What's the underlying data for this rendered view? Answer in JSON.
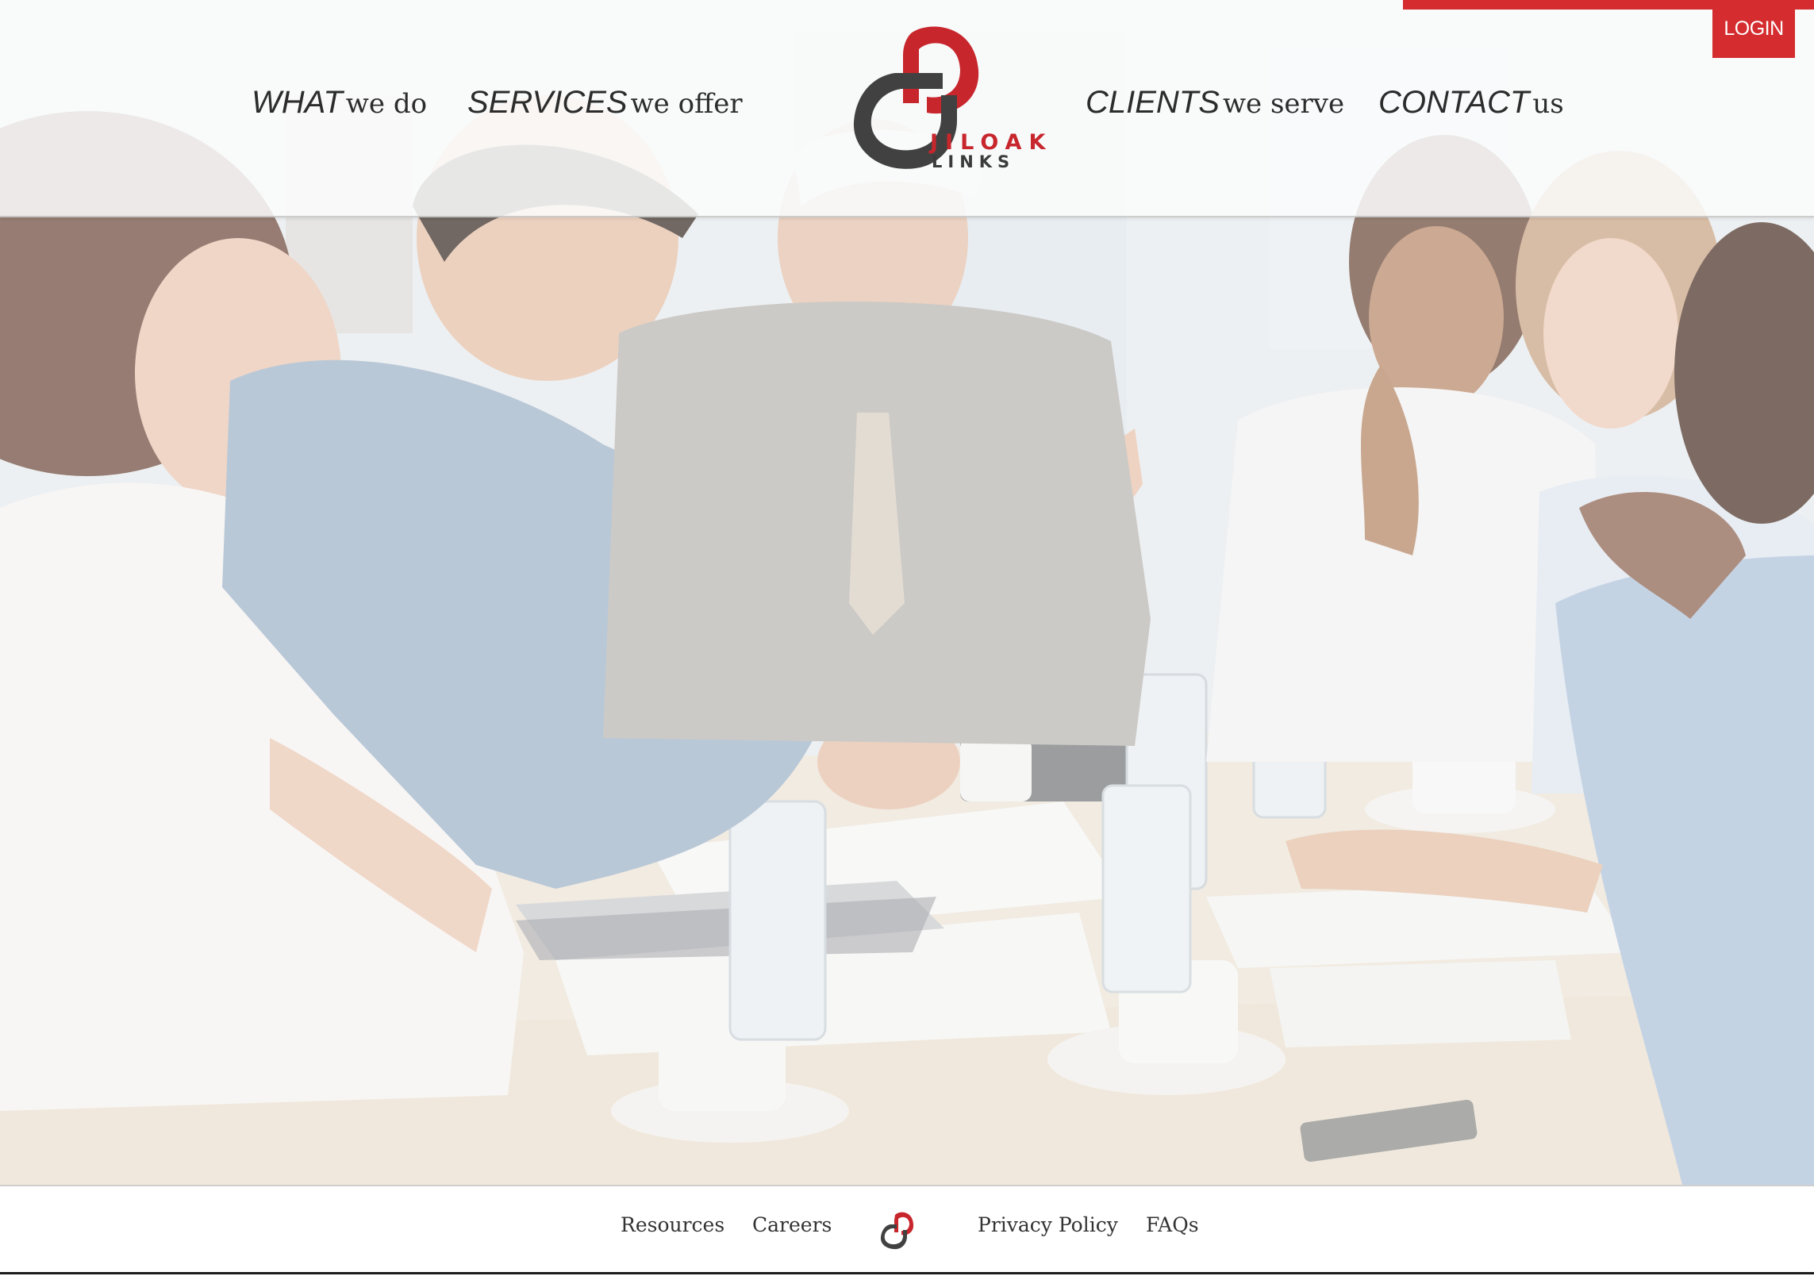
{
  "header": {
    "login_label": "LOGIN",
    "nav": [
      {
        "strong": "WHAT",
        "light": "we do"
      },
      {
        "strong": "SERVICES",
        "light": "we offer"
      },
      {
        "strong": "CLIENTS",
        "light": "we serve"
      },
      {
        "strong": "CONTACT",
        "light": "us"
      }
    ],
    "logo": {
      "line1": "JILOAK",
      "line2": "LINKS"
    }
  },
  "hero": {
    "image": "business-meeting-photo"
  },
  "footer": {
    "links": [
      "Resources",
      "Careers",
      "Privacy Policy",
      "FAQs"
    ]
  },
  "colors": {
    "accent_red": "#d42c2f",
    "logo_gray": "#3b3b3b",
    "nav_text": "#2c2c2c"
  }
}
